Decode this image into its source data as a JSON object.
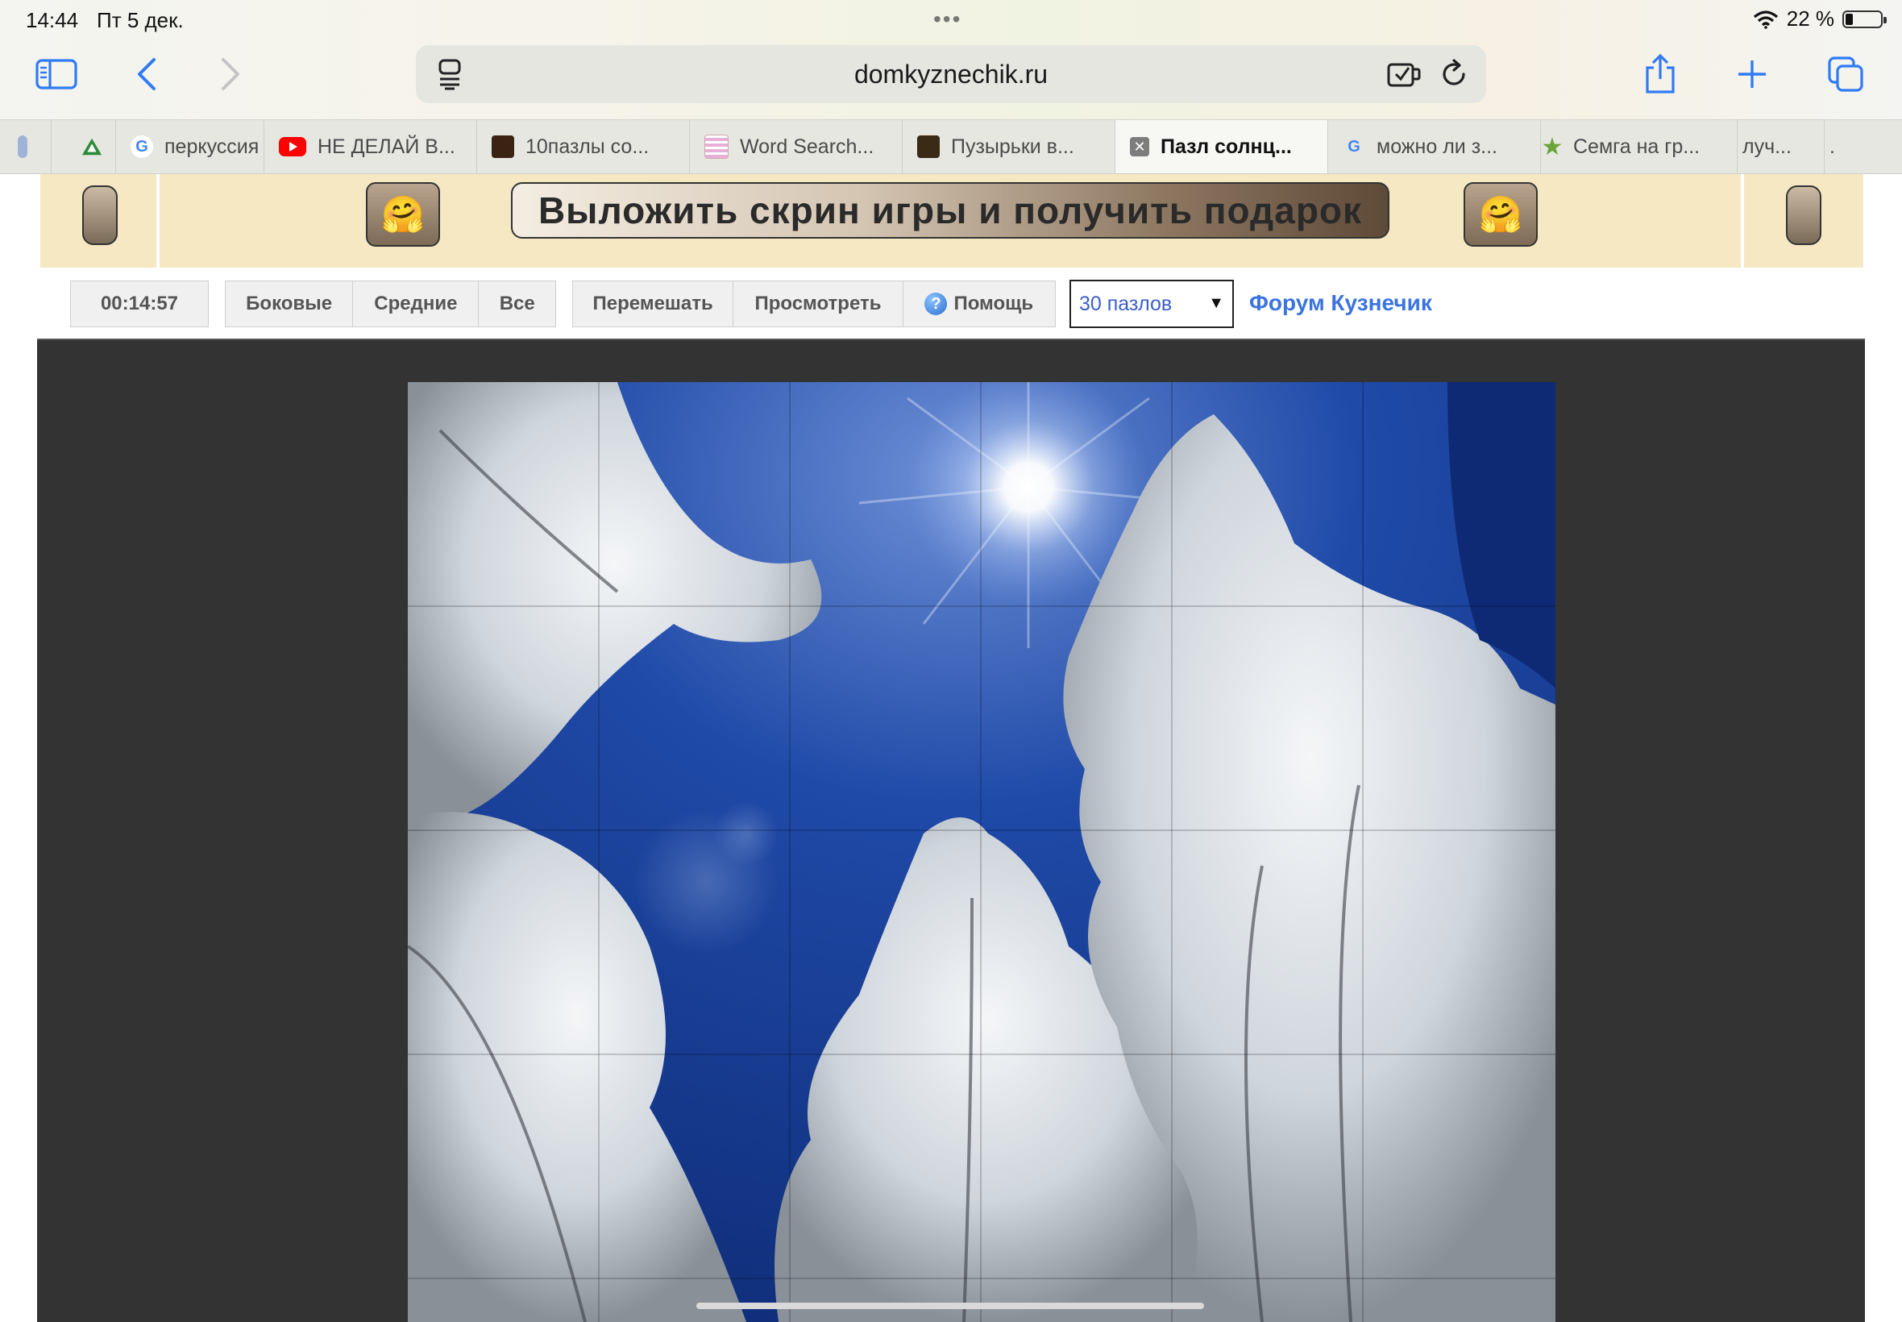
{
  "status_bar": {
    "time": "14:44",
    "date": "Пт 5 дек.",
    "battery": "22 %",
    "battery_level": 0.22
  },
  "toolbar": {
    "url": "domkyznechik.ru"
  },
  "tabs": [
    {
      "label": "",
      "icon": "partial-tab-icon"
    },
    {
      "label": "",
      "icon": "green-triangle-icon"
    },
    {
      "label": "перкуссия",
      "icon": "google-icon"
    },
    {
      "label": "НЕ ДЕЛАЙ В...",
      "icon": "youtube-icon"
    },
    {
      "label": "10пазлы со...",
      "icon": "site-thumbnail-icon"
    },
    {
      "label": "Word Search...",
      "icon": "word-search-icon"
    },
    {
      "label": "Пузырьки в...",
      "icon": "site-thumbnail-icon"
    },
    {
      "label": "Пазл солнц...",
      "icon": "close-icon",
      "active": true
    },
    {
      "label": "можно ли з...",
      "icon": "google-icon"
    },
    {
      "label": "Семга на гр...",
      "icon": "star-icon"
    },
    {
      "label": "луч...",
      "icon": ""
    },
    {
      "label": ".",
      "icon": ""
    }
  ],
  "banner": {
    "cta": "Выложить скрин игры и получить подарок",
    "emoji": "🤗"
  },
  "puzzle_controls": {
    "timer": "00:14:57",
    "filters": [
      "Боковые",
      "Средние",
      "Все"
    ],
    "shuffle": "Перемешать",
    "preview": "Просмотреть",
    "help": "Помощь",
    "pieces_select": "30 пазлов",
    "forum_link": "Форум Кузнечик"
  }
}
